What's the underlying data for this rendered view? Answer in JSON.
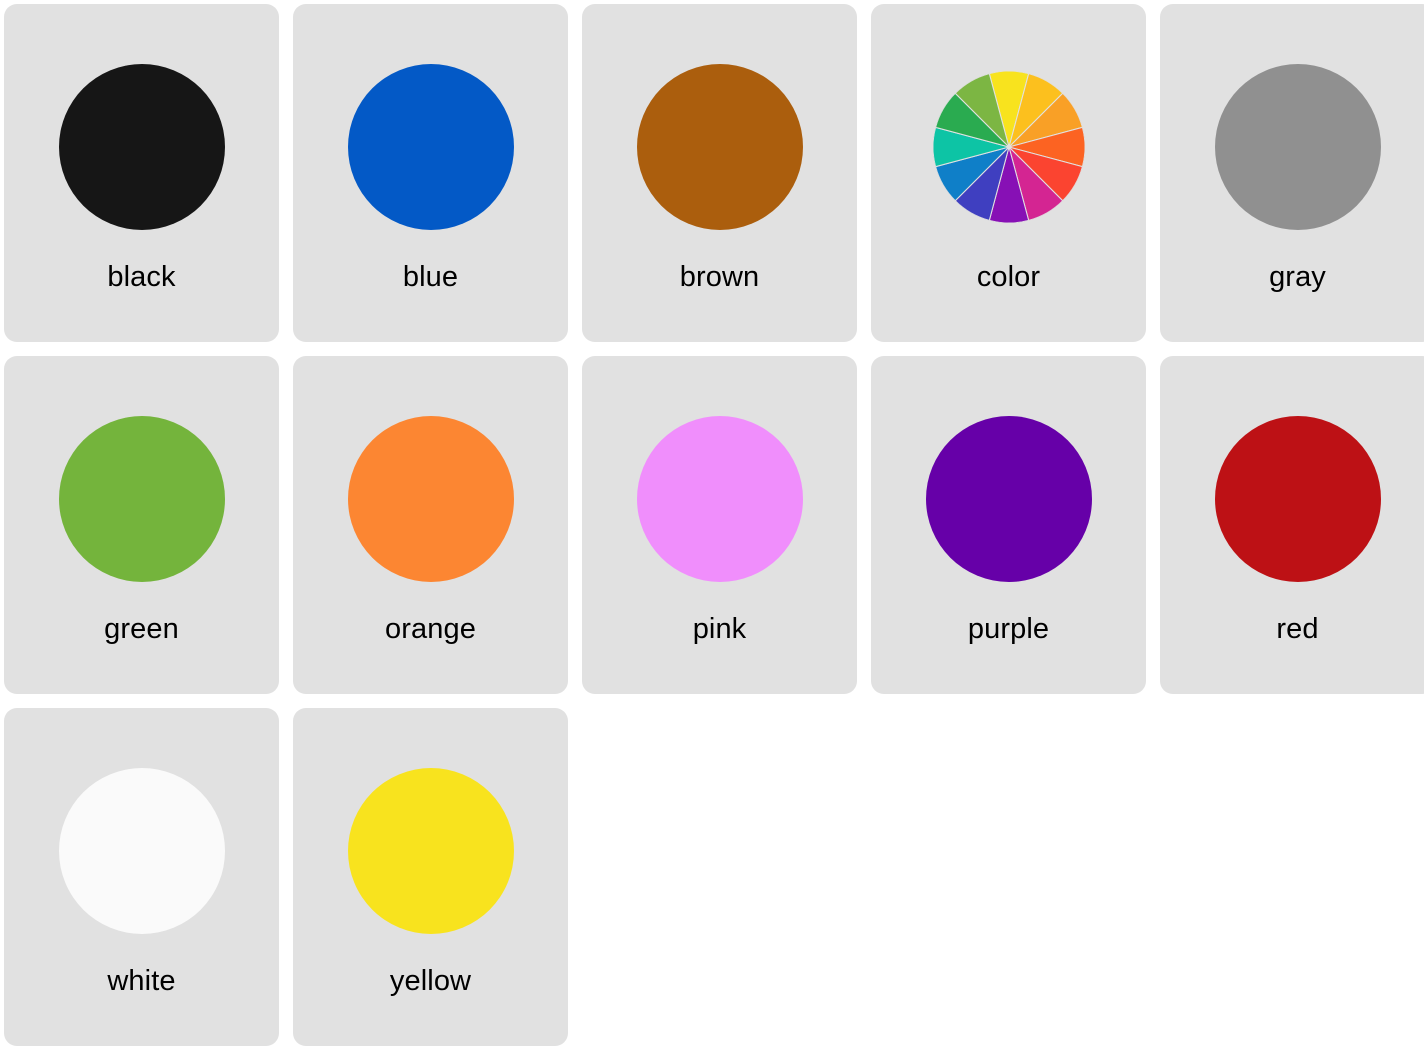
{
  "page": {
    "background_color": "#ffffff",
    "card_background_color": "#e1e1e1",
    "label_color": "#000000",
    "columns": 5,
    "total_swatches": 12
  },
  "swatches": [
    {
      "label": "black",
      "icon": "circle-swatch-black",
      "color": "#161616",
      "type": "solid"
    },
    {
      "label": "blue",
      "icon": "circle-swatch-blue",
      "color": "#0359c6",
      "type": "solid"
    },
    {
      "label": "brown",
      "icon": "circle-swatch-brown",
      "color": "#ab5e0d",
      "type": "solid"
    },
    {
      "label": "color",
      "icon": "color-wheel-swatch",
      "color": "multi",
      "type": "wheel",
      "wheel_segments": [
        "#f8e31e",
        "#fcc01e",
        "#f9a026",
        "#fc6322",
        "#fb4430",
        "#d42592",
        "#8710b5",
        "#3f3fc0",
        "#0f7fc8",
        "#0dc4a5",
        "#2aab50",
        "#7cb643"
      ]
    },
    {
      "label": "gray",
      "icon": "circle-swatch-gray",
      "color": "#909090",
      "type": "solid"
    },
    {
      "label": "green",
      "icon": "circle-swatch-green",
      "color": "#74b43c",
      "type": "solid"
    },
    {
      "label": "orange",
      "icon": "circle-swatch-orange",
      "color": "#fc8632",
      "type": "solid"
    },
    {
      "label": "pink",
      "icon": "circle-swatch-pink",
      "color": "#f08efc",
      "type": "solid"
    },
    {
      "label": "purple",
      "icon": "circle-swatch-purple",
      "color": "#6600a8",
      "type": "solid"
    },
    {
      "label": "red",
      "icon": "circle-swatch-red",
      "color": "#bd1115",
      "type": "solid"
    },
    {
      "label": "white",
      "icon": "circle-swatch-white",
      "color": "#fafafa",
      "type": "solid"
    },
    {
      "label": "yellow",
      "icon": "circle-swatch-yellow",
      "color": "#f8e31e",
      "type": "solid"
    }
  ]
}
